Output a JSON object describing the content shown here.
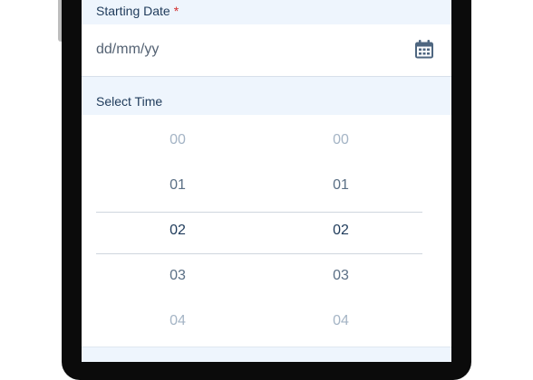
{
  "form": {
    "starting_date": {
      "label": "Starting Date",
      "required_mark": "*",
      "placeholder": "dd/mm/yy",
      "icon": "calendar-icon"
    },
    "select_time": {
      "label": "Select Time",
      "hours": [
        "00",
        "01",
        "02",
        "03",
        "04"
      ],
      "minutes": [
        "00",
        "01",
        "02",
        "03",
        "04"
      ],
      "selected_hour": "02",
      "selected_minute": "02"
    }
  },
  "colors": {
    "header_bg": "#eef5fd",
    "text_dark": "#1e3a5a",
    "required": "#d32f2f",
    "muted": "#a4b4c5"
  }
}
